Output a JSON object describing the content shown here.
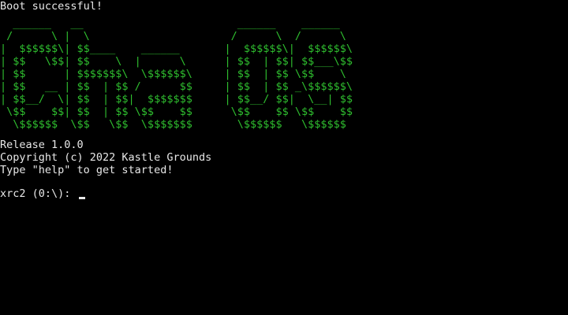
{
  "terminal": {
    "boot_message": "Boot successful!",
    "logo_lines": [
      "  ______   __                        ______    ______ ",
      " /      \\ |  \\                      /      \\  /      \\",
      "|  $$$$$$\\| $$____    ______       |  $$$$$$\\|  $$$$$$\\",
      "| $$   \\$$| $$    \\  |      \\      | $$  | $$| $$___\\$$",
      "| $$      | $$$$$$$\\  \\$$$$$$\\     | $$  | $$ \\$$    \\",
      "| $$   __ | $$  | $$ /      $$     | $$  | $$ _\\$$$$$$\\",
      "| $$__/  \\| $$  | $$|  $$$$$$$     | $$__/ $$|  \\__| $$",
      " \\$$    $$| $$  | $$ \\$$    $$      \\$$    $$ \\$$    $$",
      "  \\$$$$$$  \\$$   \\$$  \\$$$$$$$       \\$$$$$$   \\$$$$$$"
    ],
    "logo_color": "#2fbf2f",
    "text_color": "#e8e8e8",
    "background_color": "#000000",
    "release_line": "Release 1.0.0",
    "copyright_line": "Copyright (c) 2022 Kastle Grounds",
    "help_line": "Type \"help\" to get started!",
    "prompt": "xrc2 (0:\\): "
  }
}
